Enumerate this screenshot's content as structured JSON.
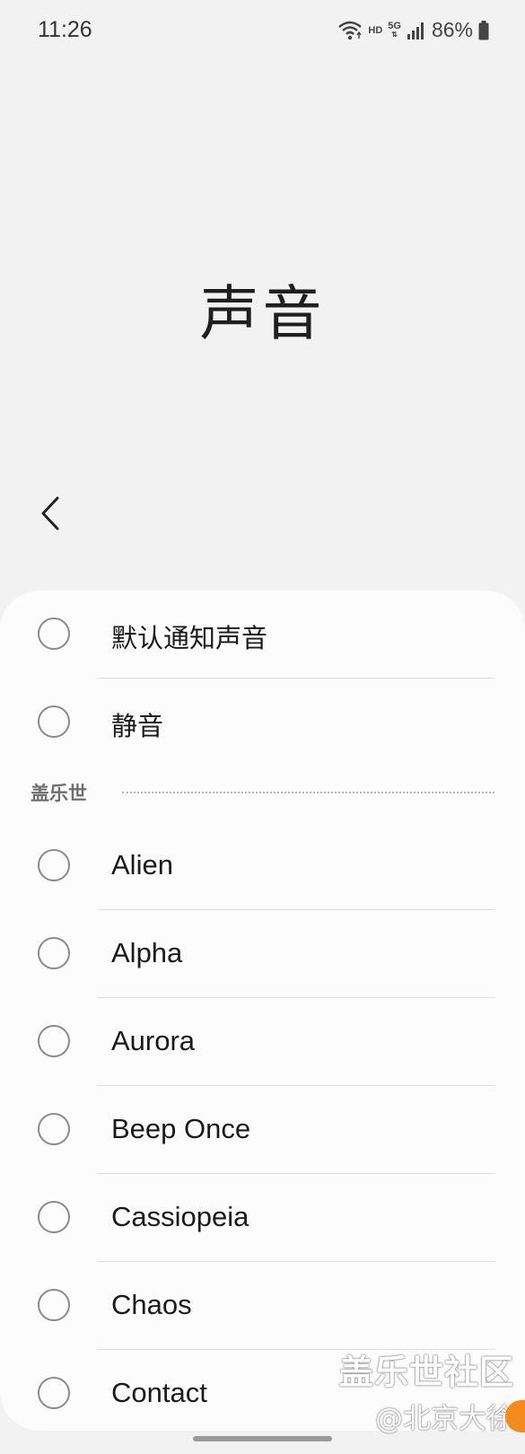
{
  "status_bar": {
    "time": "11:26",
    "hd": "HD",
    "network": "5G",
    "battery_percent": "86%",
    "icons": [
      "wifi-icon",
      "signal-icon",
      "battery-icon"
    ]
  },
  "header": {
    "title": "声音",
    "back_icon": "chevron-left-icon"
  },
  "list": {
    "top_items": [
      {
        "label": "默认通知声音",
        "selected": false
      },
      {
        "label": "静音",
        "selected": false
      }
    ],
    "section": {
      "label": "盖乐世",
      "items": [
        {
          "label": "Alien",
          "selected": false
        },
        {
          "label": "Alpha",
          "selected": false
        },
        {
          "label": "Aurora",
          "selected": false
        },
        {
          "label": "Beep Once",
          "selected": false
        },
        {
          "label": "Cassiopeia",
          "selected": false
        },
        {
          "label": "Chaos",
          "selected": false
        },
        {
          "label": "Contact",
          "selected": false
        }
      ]
    }
  },
  "watermark": {
    "line1": "盖乐世社区",
    "line2": "@北京大徐"
  },
  "colors": {
    "background": "#f2f2f2",
    "sheet": "#fcfcfc",
    "radio_border": "#8a8a8a",
    "divider": "#dcdcdc",
    "accent_badge": "#f58a1f"
  }
}
